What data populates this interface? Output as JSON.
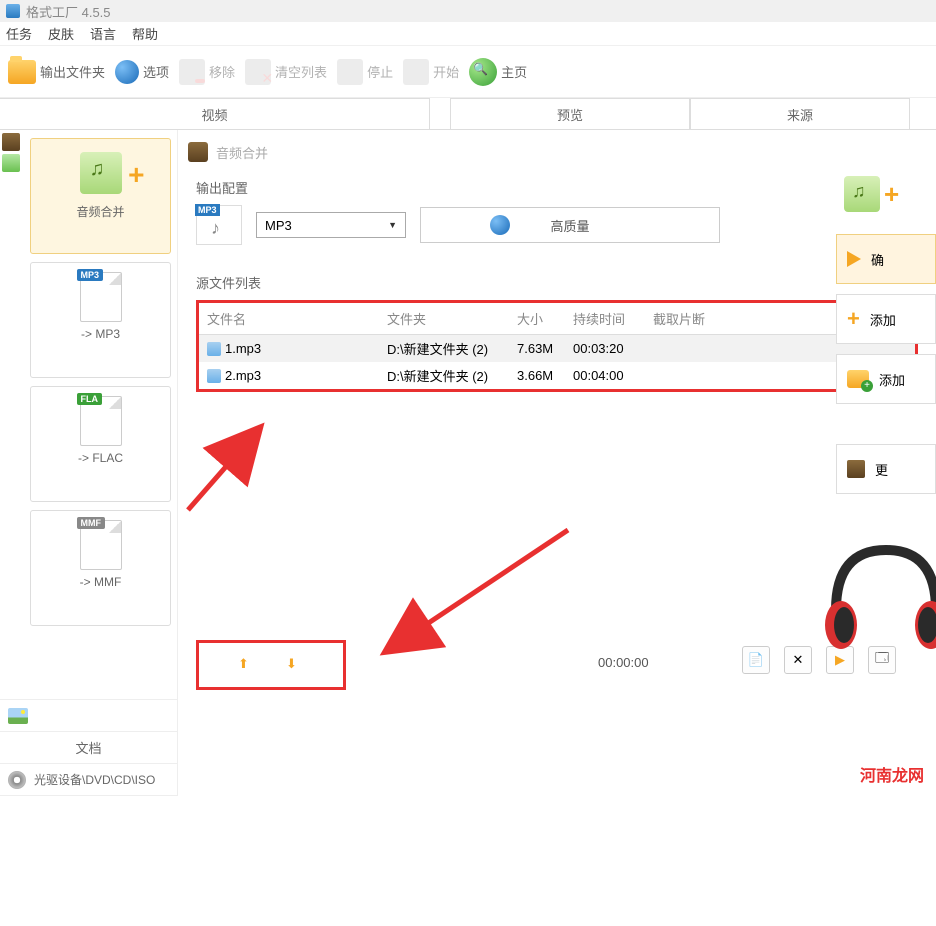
{
  "title": "格式工厂 4.5.5",
  "menu": {
    "task": "任务",
    "skin": "皮肤",
    "lang": "语言",
    "help": "帮助"
  },
  "toolbar": {
    "output": "输出文件夹",
    "options": "选项",
    "remove": "移除",
    "clear": "清空列表",
    "stop": "停止",
    "start": "开始",
    "home": "主页"
  },
  "tabs": {
    "video": "视频",
    "preview": "预览",
    "source": "来源"
  },
  "formats": {
    "merge": "音频合并",
    "mp3": "-> MP3",
    "flac": "-> FLAC",
    "mmf": "-> MMF"
  },
  "bottom_nav": {
    "doc": "文档",
    "disc": "光驱设备\\DVD\\CD\\ISO"
  },
  "dialog": {
    "title": "音频合并",
    "output_config": "输出配置",
    "format": "MP3",
    "quality": "高质量",
    "source_list": "源文件列表",
    "cols": {
      "name": "文件名",
      "folder": "文件夹",
      "size": "大小",
      "duration": "持续时间",
      "clip": "截取片断"
    },
    "rows": [
      {
        "name": "1.mp3",
        "folder": "D:\\新建文件夹 (2)",
        "size": "7.63M",
        "duration": "00:03:20"
      },
      {
        "name": "2.mp3",
        "folder": "D:\\新建文件夹 (2)",
        "size": "3.66M",
        "duration": "00:04:00"
      }
    ],
    "total_time": "00:00:00"
  },
  "right": {
    "ok": "确",
    "add": "添加",
    "add_folder": "添加",
    "change": "更"
  },
  "watermark": "河南龙网"
}
